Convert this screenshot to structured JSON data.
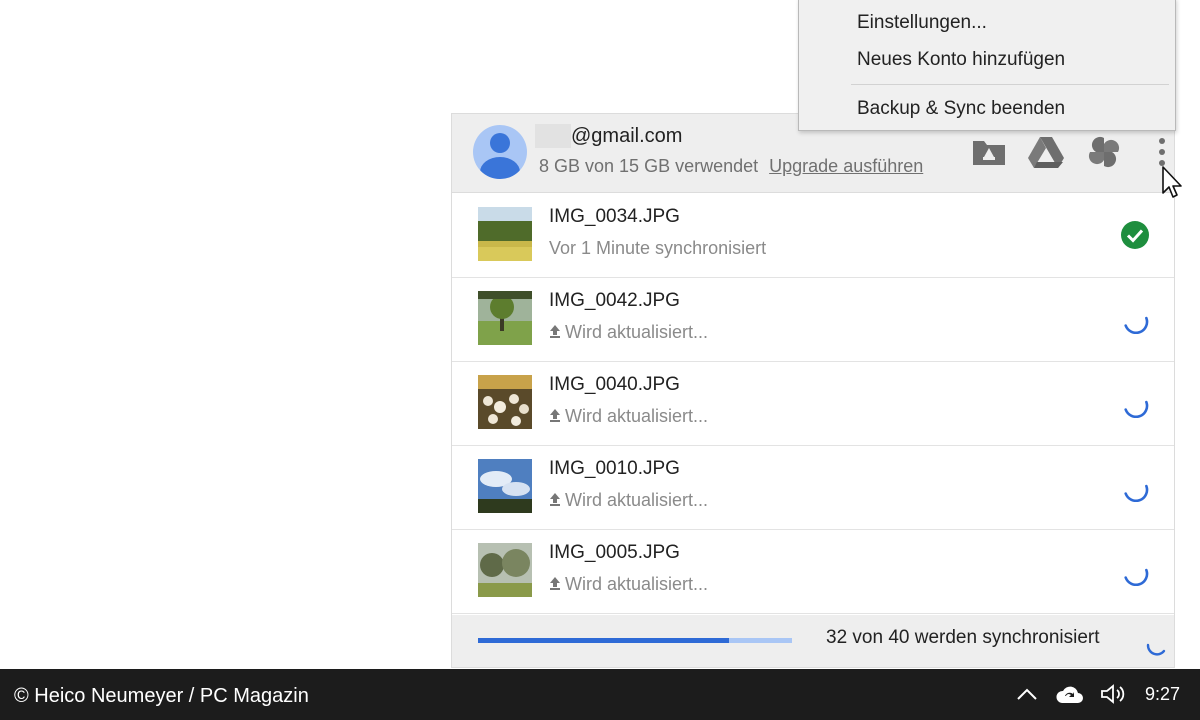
{
  "menu": {
    "items": [
      "Einstellungen...",
      "Neues Konto hinzufügen",
      "Backup & Sync beenden"
    ]
  },
  "account": {
    "email": "@gmail.com",
    "usage_text": "8 GB von 15 GB verwendet",
    "upgrade_link": "Upgrade ausführen",
    "icons": [
      "folder-icon",
      "drive-icon",
      "photos-icon",
      "more-vert-icon"
    ]
  },
  "files": [
    {
      "name": "IMG_0034.JPG",
      "status": "Vor 1 Minute synchronisiert",
      "state": "synced"
    },
    {
      "name": "IMG_0042.JPG",
      "status": "Wird aktualisiert...",
      "state": "uploading"
    },
    {
      "name": "IMG_0040.JPG",
      "status": "Wird aktualisiert...",
      "state": "uploading"
    },
    {
      "name": "IMG_0010.JPG",
      "status": "Wird aktualisiert...",
      "state": "uploading"
    },
    {
      "name": "IMG_0005.JPG",
      "status": "Wird aktualisiert...",
      "state": "uploading"
    }
  ],
  "footer": {
    "sync_text": "32 von 40 werden synchronisiert",
    "progress": 0.8
  },
  "taskbar": {
    "credit": "© Heico Neumeyer / PC Magazin",
    "time": "9:27",
    "tray_icons": [
      "chevron-up-icon",
      "cloud-sync-icon",
      "speaker-icon"
    ]
  },
  "colors": {
    "accent_blue": "#2e6ad6",
    "success_green": "#1e8e3e",
    "panel_header_bg": "#eeeeee",
    "taskbar_bg": "#1c1c1c"
  }
}
